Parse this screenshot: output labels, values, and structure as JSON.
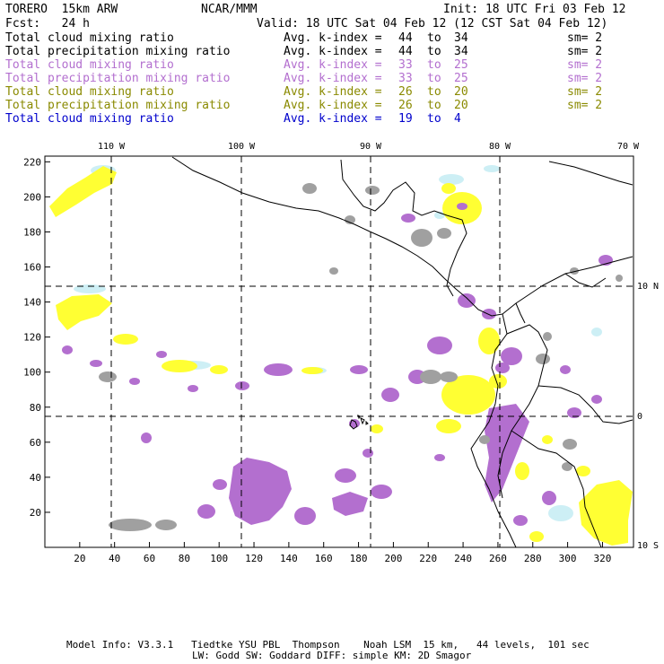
{
  "header": {
    "model": "TORERO  15km ARW",
    "org": "NCAR/MMM",
    "init": "Init: 18 UTC Fri 03 Feb 12",
    "fcst": "Fcst:   24 h",
    "valid": "Valid: 18 UTC Sat 04 Feb 12 (12 CST Sat 04 Feb 12)"
  },
  "legend": [
    {
      "field": "Total cloud mixing ratio",
      "k_label": "Avg. k-index =",
      "k_hi": "44",
      "to": "to",
      "k_lo": "34",
      "sm": "sm= 2",
      "color": "#000000"
    },
    {
      "field": "Total precipitation mixing ratio",
      "k_label": "Avg. k-index =",
      "k_hi": "44",
      "to": "to",
      "k_lo": "34",
      "sm": "sm= 2",
      "color": "#000000"
    },
    {
      "field": "Total cloud mixing ratio",
      "k_label": "Avg. k-index =",
      "k_hi": "33",
      "to": "to",
      "k_lo": "25",
      "sm": "sm= 2",
      "color": "#b36fcf"
    },
    {
      "field": "Total precipitation mixing ratio",
      "k_label": "Avg. k-index =",
      "k_hi": "33",
      "to": "to",
      "k_lo": "25",
      "sm": "sm= 2",
      "color": "#b36fcf"
    },
    {
      "field": "Total cloud mixing ratio",
      "k_label": "Avg. k-index =",
      "k_hi": "26",
      "to": "to",
      "k_lo": "20",
      "sm": "sm= 2",
      "color": "#8a8a00"
    },
    {
      "field": "Total precipitation mixing ratio",
      "k_label": "Avg. k-index =",
      "k_hi": "26",
      "to": "to",
      "k_lo": "20",
      "sm": "sm= 2",
      "color": "#8a8a00"
    },
    {
      "field": "Total cloud mixing ratio",
      "k_label": "Avg. k-index =",
      "k_hi": "19",
      "to": "to",
      "k_lo": "4",
      "sm": "",
      "color": "#0000cc"
    }
  ],
  "longitude_labels": [
    "110 W",
    "100 W",
    "90 W",
    "80 W",
    "70 W"
  ],
  "latitude_labels": [
    "10 N",
    "0",
    "10 S"
  ],
  "x_ticks": [
    "20",
    "40",
    "60",
    "80",
    "100",
    "120",
    "140",
    "160",
    "180",
    "200",
    "220",
    "240",
    "260",
    "280",
    "300",
    "320"
  ],
  "y_ticks": [
    "220",
    "200",
    "180",
    "160",
    "140",
    "120",
    "100",
    "80",
    "60",
    "40",
    "20"
  ],
  "footer": {
    "line1": "Model Info: V3.3.1   Tiedtke YSU PBL  Thompson    Noah LSM  15 km,   44 levels,  101 sec",
    "line2": "LW: Godd SW: Goddard DIFF: simple KM: 2D Smagor"
  },
  "colors": {
    "heavy_cloud": "#a0a0a0",
    "purple_cloud": "#b36fcf",
    "yellow_cloud": "#ffff33",
    "light_blue_cloud": "#cdeff5",
    "coast": "#000000"
  }
}
